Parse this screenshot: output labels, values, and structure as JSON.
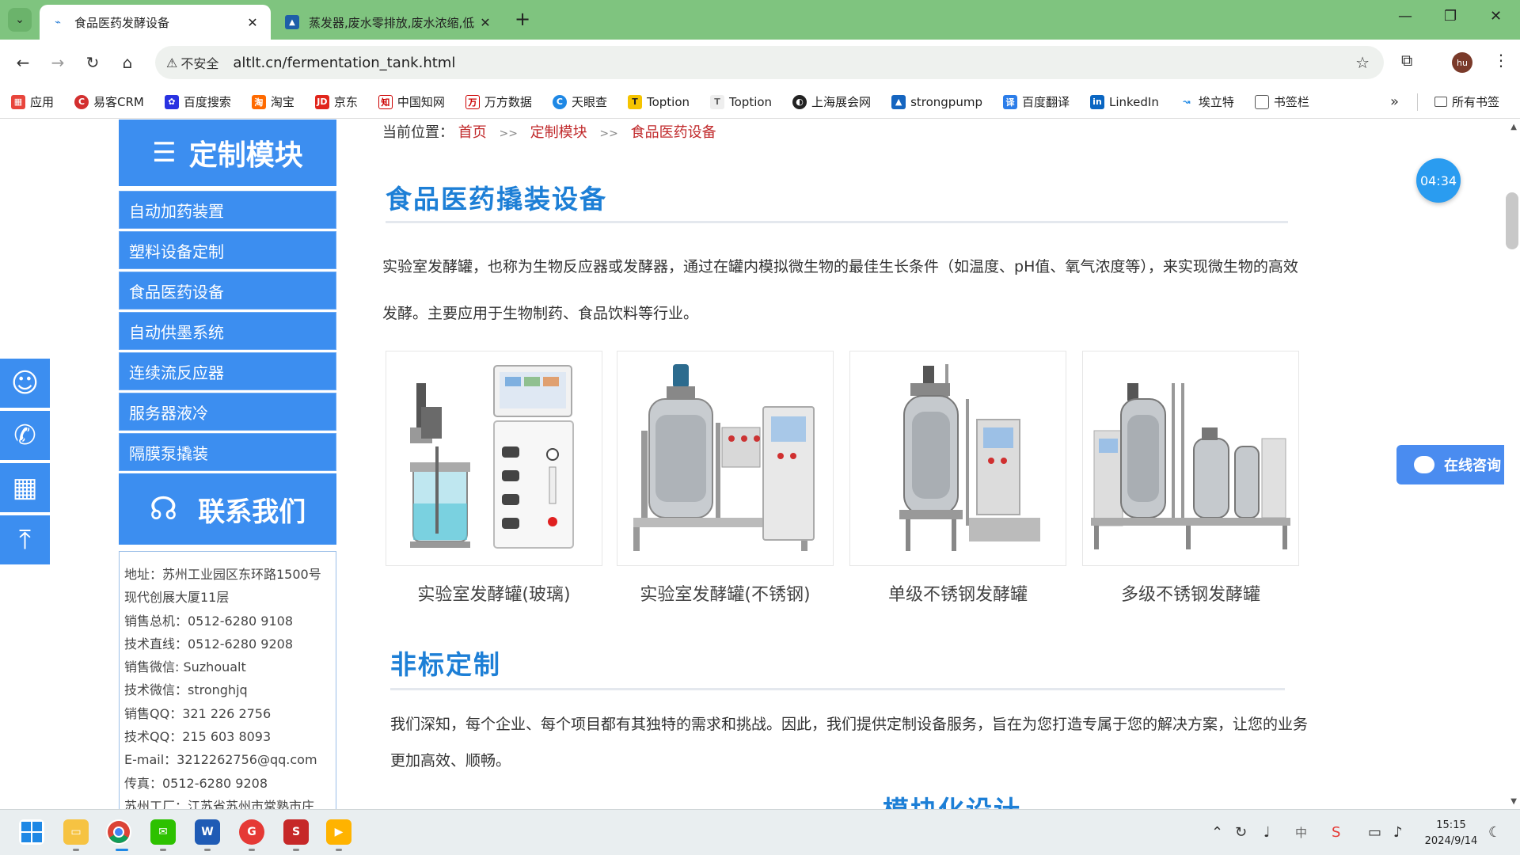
{
  "browser": {
    "tabs": [
      {
        "title": "食品医药发酵设备",
        "active": true
      },
      {
        "title": "蒸发器,废水零排放,废水浓缩,低",
        "active": false
      }
    ],
    "url": "altlt.cn/fermentation_tank.html",
    "security_label": "不安全",
    "profile_initials": "hu",
    "bookmarks": [
      "应用",
      "易客CRM",
      "百度搜索",
      "淘宝",
      "京东",
      "中国知网",
      "万方数据",
      "天眼查",
      "Toption",
      "Toption",
      "上海展会网",
      "strongpump",
      "百度翻译",
      "LinkedIn",
      "埃立特",
      "书签栏"
    ],
    "all_bookmarks_label": "所有书签"
  },
  "sidebar": {
    "title": "定制模块",
    "items": [
      "自动加药装置",
      "塑料设备定制",
      "食品医药设备",
      "自动供墨系统",
      "连续流反应器",
      "服务器液冷",
      "隔膜泵撬装"
    ],
    "contact_title": "联系我们",
    "contact_lines": [
      "地址：苏州工业园区东环路1500号",
      "现代创展大厦11层",
      "销售总机：0512-6280 9108",
      "技术直线：0512-6280 9208",
      "销售微信: Suzhoualt",
      "技术微信：stronghjq",
      "销售QQ：321 226 2756",
      "技术QQ：215 603 8093",
      "E-mail：3212262756@qq.com",
      "传真：0512-6280 9208",
      "苏州工厂：江苏省苏州市常熟市庄"
    ]
  },
  "breadcrumb": {
    "prefix": "当前位置：",
    "items": [
      "首页",
      "定制模块",
      "食品医药设备"
    ],
    "separator": ">>"
  },
  "main": {
    "section1_title": "食品医药撬装设备",
    "intro": "实验室发酵罐，也称为生物反应器或发酵器，通过在罐内模拟微生物的最佳生长条件（如温度、pH值、氧气浓度等），来实现微生物的高效发酵。主要应用于生物制药、食品饮料等行业。",
    "products": [
      {
        "caption": "实验室发酵罐(玻璃)"
      },
      {
        "caption": "实验室发酵罐(不锈钢)"
      },
      {
        "caption": "单级不锈钢发酵罐"
      },
      {
        "caption": "多级不锈钢发酵罐"
      }
    ],
    "section2_title": "非标定制",
    "custom_text": "我们深知，每个企业、每个项目都有其独特的需求和挑战。因此，我们提供定制设备服务，旨在为您打造专属于您的解决方案，让您的业务更加高效、顺畅。",
    "section3_title": "模块化设计"
  },
  "widgets": {
    "timer": "04:34",
    "consult_label": "在线咨询"
  },
  "taskbar": {
    "time": "15:15",
    "date": "2024/9/14"
  },
  "colors": {
    "sidebar_blue": "#3c8ef0",
    "title_blue": "#1d7fd6",
    "link_red": "#c0282a",
    "tabbar_green": "#7fc47f"
  }
}
